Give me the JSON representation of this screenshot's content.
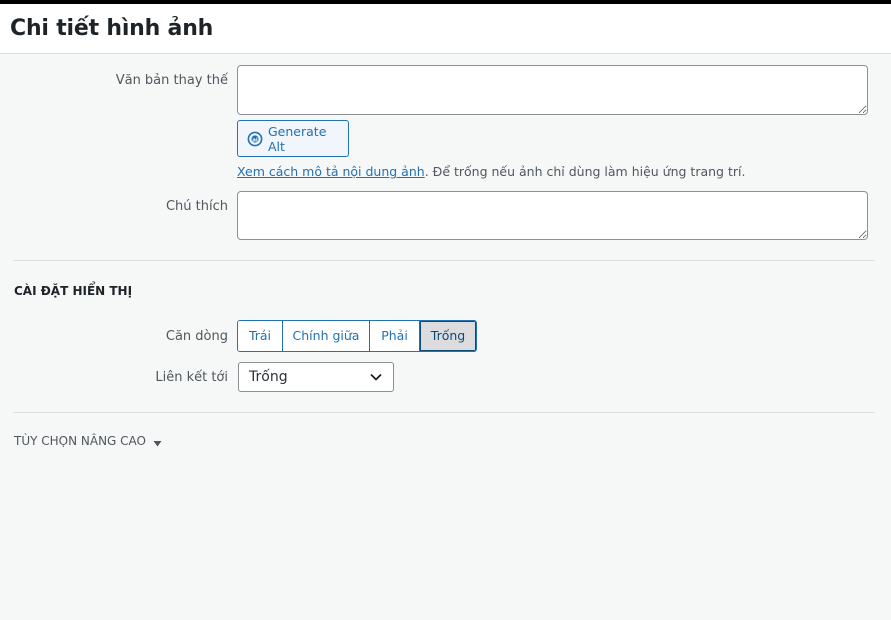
{
  "header": {
    "title": "Chi tiết hình ảnh"
  },
  "alt_text": {
    "label": "Văn bản thay thế",
    "value": ""
  },
  "generate_button": {
    "label": "Generate Alt"
  },
  "help": {
    "link_text": "Xem cách mô tả nội dung ảnh",
    "text": ". Để trống nếu ảnh chỉ dùng làm hiệu ứng trang trí."
  },
  "caption": {
    "label": "Chú thích",
    "value": ""
  },
  "display_settings": {
    "title": "CÀI ĐẶT HIỂN THỊ",
    "align_label": "Căn dòng",
    "align_options": [
      "Trái",
      "Chính giữa",
      "Phải",
      "Trống"
    ],
    "align_selected": "Trống",
    "link_label": "Liên kết tới",
    "link_value": "Trống"
  },
  "advanced": {
    "label": "TÙY CHỌN NÂNG CAO"
  },
  "colors": {
    "accent": "#2271b1",
    "background": "#f6f7f7",
    "border": "#8c8f94"
  },
  "icons": {
    "generate": "ai-icon",
    "select": "chevron-down-icon",
    "advanced": "triangle-down-icon"
  }
}
